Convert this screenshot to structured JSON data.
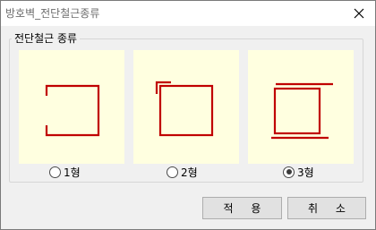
{
  "window": {
    "title": "방호벽_전단철근종류"
  },
  "icons": {
    "close": "close-icon"
  },
  "group": {
    "label": "전단철근 종류"
  },
  "options": [
    {
      "label": "1형",
      "selected": false
    },
    {
      "label": "2형",
      "selected": false
    },
    {
      "label": "3형",
      "selected": true
    }
  ],
  "buttons": {
    "apply": "적 용",
    "cancel": "취 소"
  },
  "colors": {
    "rebar": "#c00000",
    "panel_bg": "#ffffe0"
  }
}
